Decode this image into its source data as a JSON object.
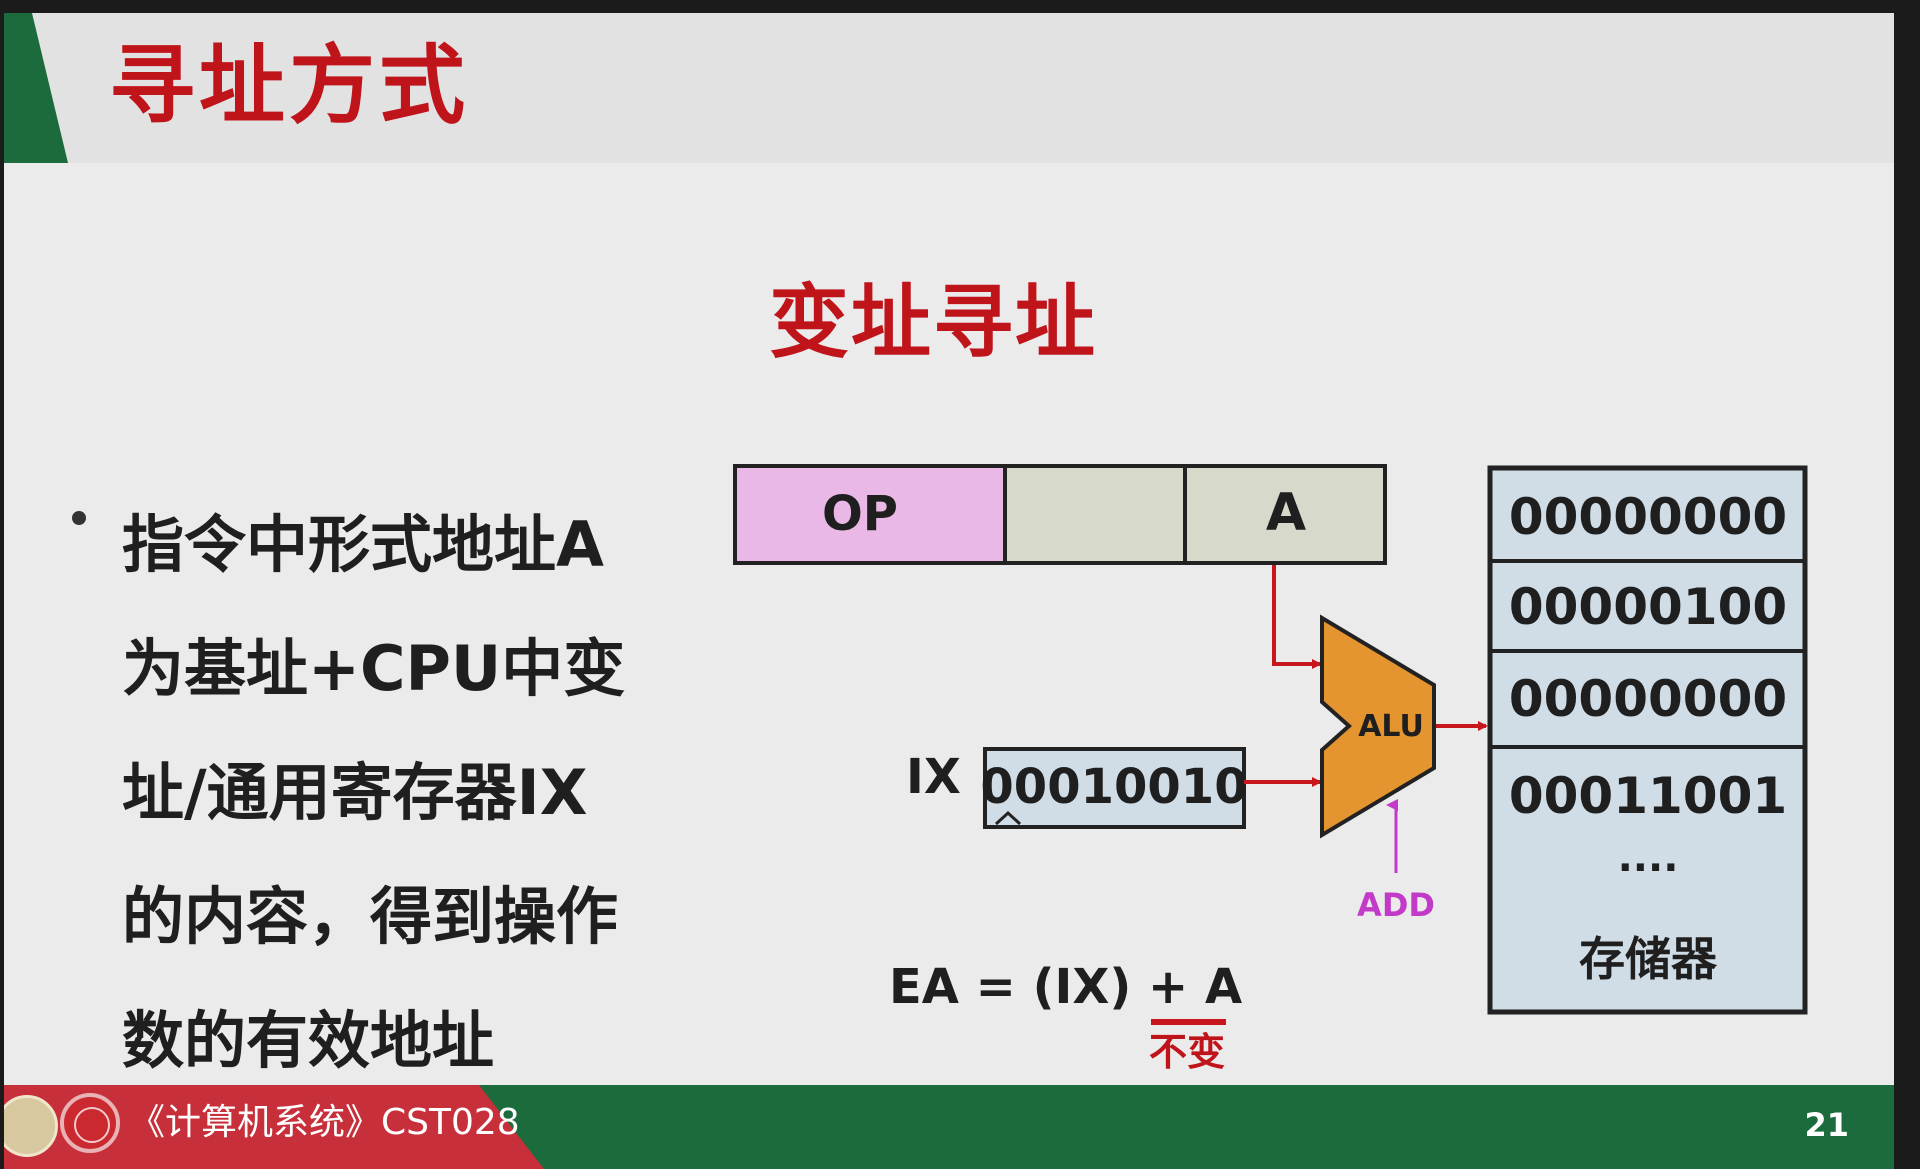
{
  "slide": {
    "title": "寻址方式",
    "subtitle": "变址寻址",
    "bullet_lines": [
      "指令中形式地址A",
      "为基址+CPU中变",
      "址/通用寄存器IX",
      "的内容，得到操作",
      "数的有效地址"
    ]
  },
  "instruction": {
    "op_label": "OP",
    "a_label": "A"
  },
  "register": {
    "name": "IX",
    "value": "00010010"
  },
  "alu": {
    "label": "ALU",
    "operation": "ADD"
  },
  "memory": {
    "cells": [
      "00000000",
      "00000100",
      "00000000",
      "00011001"
    ],
    "ellipsis": "····",
    "label": "存储器"
  },
  "formula": {
    "text": "EA = (IX) + A",
    "note": "不变"
  },
  "footer": {
    "course": "《计算机系统》CST028",
    "page": "21"
  },
  "colors": {
    "title_red": "#c0141b",
    "footer_green": "#1c6b3c",
    "footer_red": "#c7303a",
    "op_field": "#e9b8e6",
    "field_gray": "#d7d9ca",
    "alu_orange": "#e5952f",
    "memory_blue": "#d0dde6",
    "arrow_red": "#c8161d",
    "add_magenta": "#c23bc8"
  }
}
